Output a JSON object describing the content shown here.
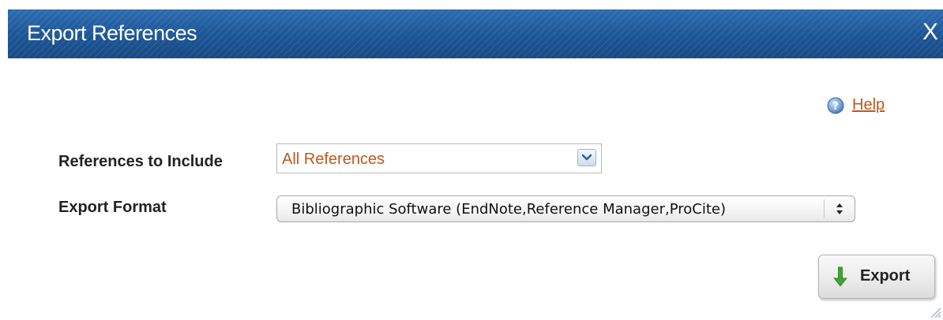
{
  "dialog": {
    "title": "Export References",
    "close_label": "X"
  },
  "help": {
    "icon": "help-circle-icon",
    "label": "Help"
  },
  "form": {
    "include": {
      "label": "References to Include",
      "selected": "All References",
      "icon": "chevron-down-icon"
    },
    "format": {
      "label": "Export Format",
      "selected": "Bibliographic Software (EndNote,Reference Manager,ProCite)",
      "icon": "up-down-arrows-icon"
    }
  },
  "actions": {
    "export_label": "Export",
    "export_icon": "down-arrow-icon"
  },
  "colors": {
    "titlebar": "#1f5a99",
    "accent_text": "#c0571d",
    "export_arrow": "#3fa632"
  }
}
